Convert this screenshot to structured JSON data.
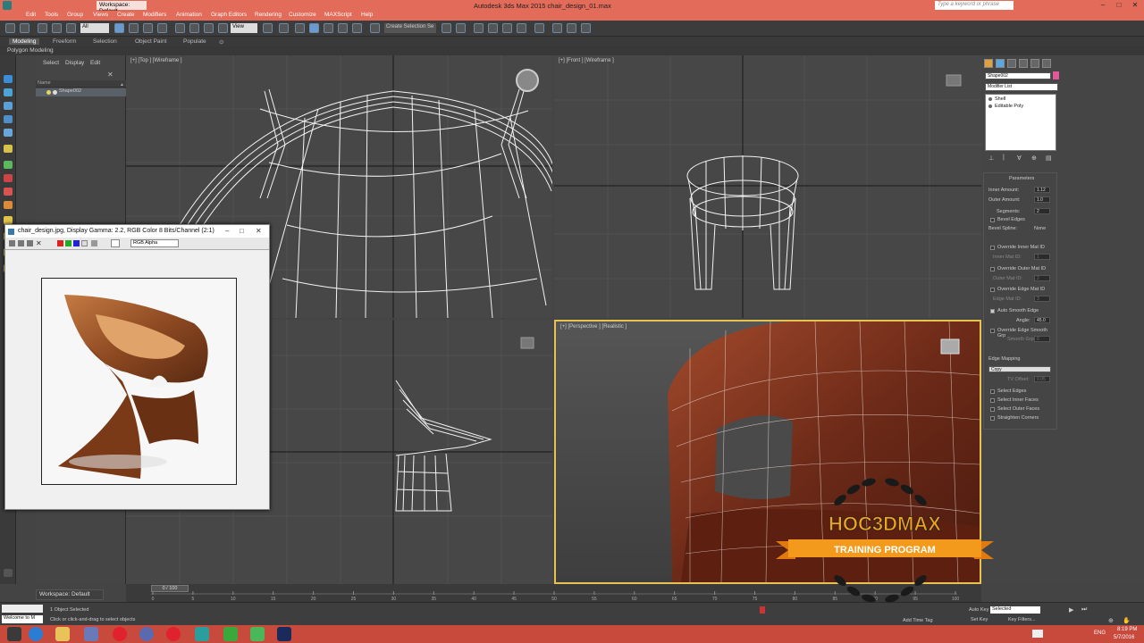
{
  "app": {
    "window_title": "Autodesk 3ds Max  2015      chair_design_01.max",
    "workspace": "Workspace: Default",
    "help_search_placeholder": "Type a keyword or phrase"
  },
  "menu": [
    "Edit",
    "Tools",
    "Group",
    "Views",
    "Create",
    "Modifiers",
    "Animation",
    "Graph Editors",
    "Rendering",
    "Customize",
    "MAXScript",
    "Help"
  ],
  "toolbar": {
    "filter_select": "All",
    "view_select": "View",
    "named_selection": "Create Selection Se"
  },
  "ribbon": {
    "tabs": [
      "Modeling",
      "Freeform",
      "Selection",
      "Object Paint",
      "Populate"
    ],
    "subtitle": "Polygon Modeling"
  },
  "scene_explorer": {
    "menus": [
      "Select",
      "Display",
      "Edit"
    ],
    "column_header": "Name",
    "items": [
      "Shape002"
    ]
  },
  "viewports": {
    "top": "[+] [Top ] [Wireframe ]",
    "front": "[+] [Front ] [Wireframe ]",
    "left": "",
    "perspective": "[+] [Perspective ] [Realistic ]"
  },
  "image_window": {
    "title": "chair_design.jpg, Display Gamma: 2.2, RGB Color 8 Bits/Channel (2:1)",
    "channel": "RGB Alpha"
  },
  "command_panel": {
    "object_name": "Shape002",
    "modifier_list": "Modifier List",
    "stack": [
      "Shell",
      "Editable Poly"
    ],
    "rollout_title": "Parameters",
    "params": [
      {
        "label": "Inner Amount:",
        "value": "1.12"
      },
      {
        "label": "Outer Amount:",
        "value": "1.0"
      },
      {
        "label": "Segments:",
        "value": "2"
      }
    ],
    "bevel_edges": "Bevel Edges",
    "bevel_spline_label": "Bevel Spline:",
    "bevel_spline_value": "None",
    "override_inner": "Override Inner Mat ID",
    "inner_mat_id": "Inner Mat ID:",
    "inner_mat_val": "1",
    "override_outer": "Override Outer Mat ID",
    "outer_mat_id": "Outer Mat ID:",
    "outer_mat_val": "2",
    "override_edge": "Override Edge Mat ID",
    "edge_mat_id": "Edge Mat ID:",
    "edge_mat_val": "3",
    "auto_smooth": "Auto Smooth Edge",
    "angle_label": "Angle:",
    "angle_value": "45.0",
    "override_smooth": "Override Edge Smooth Grp",
    "smooth_grp_label": "Smooth Grp:",
    "smooth_grp_value": "0",
    "edge_mapping": "Edge Mapping",
    "edge_mapping_value": "Copy",
    "tv_offset_label": "TV Offset:",
    "tv_offset_value": "0.05",
    "select_edges": "Select Edges",
    "select_inner": "Select Inner Faces",
    "select_outer": "Select Outer Faces",
    "straighten": "Straighten Corners"
  },
  "timeline": {
    "frame": "0 / 100",
    "ticks": [
      "0",
      "5",
      "10",
      "15",
      "20",
      "25",
      "30",
      "35",
      "40",
      "45",
      "50",
      "55",
      "60",
      "65",
      "70",
      "75",
      "80",
      "85",
      "90",
      "95",
      "100"
    ]
  },
  "status": {
    "selected": "1 Object Selected",
    "prompt": "Click or click-and-drag to select objects",
    "welcome": "Welcome to M",
    "auto_key": "Auto Key",
    "set_key": "Set Key",
    "key_mode": "Selected",
    "key_filters": "Key Filters...",
    "add_time_tag": "Add Time Tag"
  },
  "logo": {
    "brand": "HOC3DMAX",
    "banner": "TRAINING PROGRAM"
  },
  "taskbar": {
    "lang": "ENG",
    "time": "8:19 PM",
    "date": "5/7/2016"
  },
  "colors": {
    "title_bar": "#e36b5a",
    "taskbar": "#c74a3d",
    "active_viewport": "#e8c24e",
    "banner": "#f39a1c"
  }
}
